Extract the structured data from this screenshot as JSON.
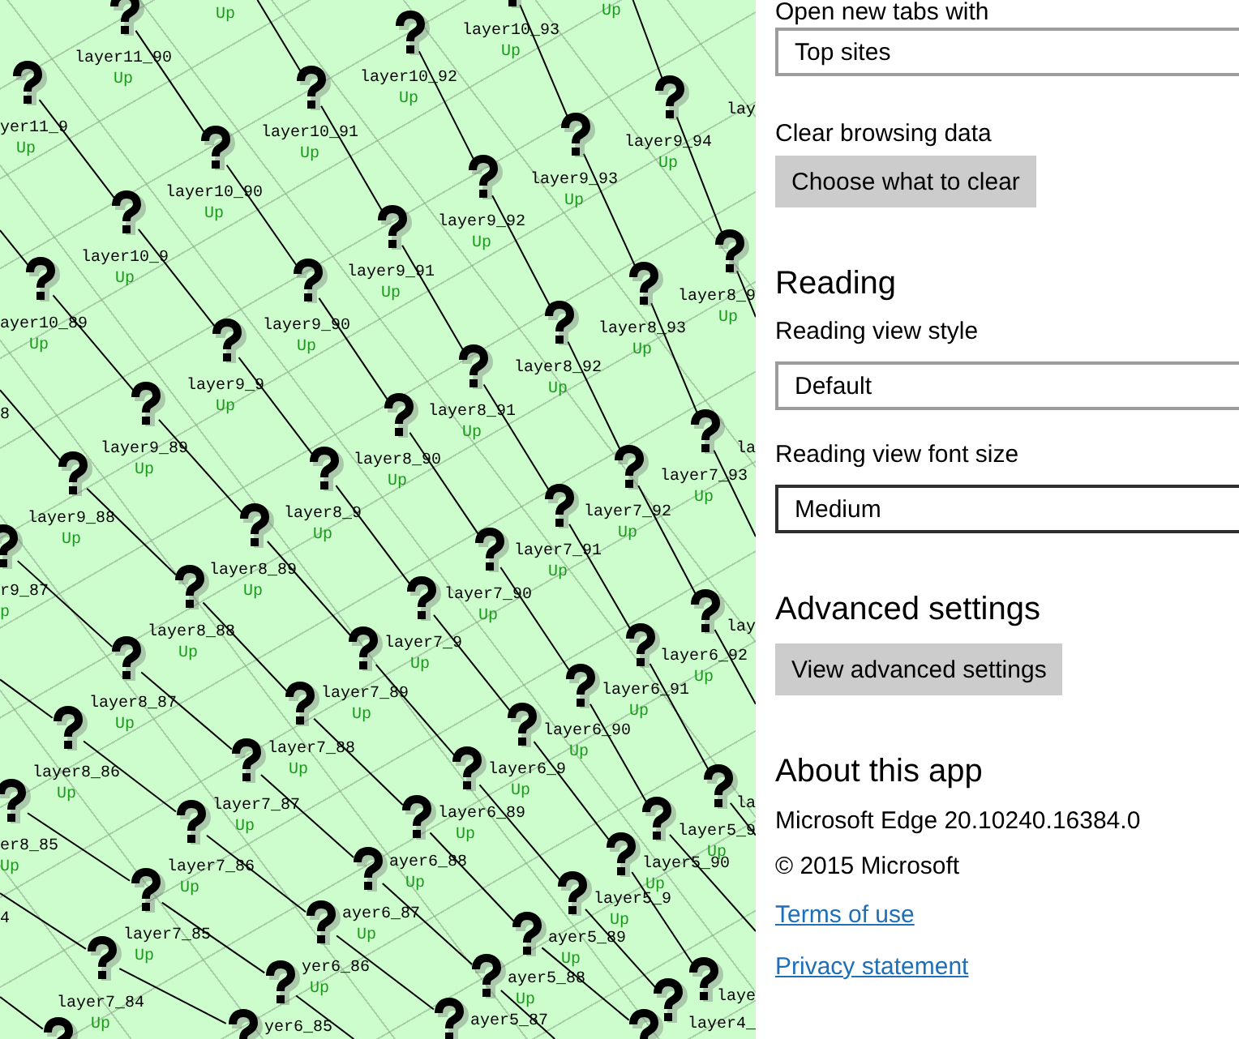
{
  "network_map": {
    "chains": [
      {
        "nodes": [
          {
            "kind": "unknown"
          }
        ]
      },
      {
        "nodes": [
          {
            "label": "4"
          },
          {
            "kind": "unknown",
            "label": "layer7_84",
            "status": "Up"
          },
          {
            "kind": "unknown"
          }
        ]
      },
      {
        "nodes": [
          {
            "kind": "unknown",
            "label": "er8_85",
            "status": "Up"
          },
          {
            "kind": "unknown",
            "label": "layer7_85",
            "status": "Up"
          },
          {
            "kind": "unknown",
            "label": "yer6_85"
          }
        ]
      },
      {
        "nodes": [
          {
            "kind": "unknown",
            "label": "layer8_86",
            "status": "Up"
          },
          {
            "kind": "unknown",
            "label": "layer7_86",
            "status": "Up"
          },
          {
            "kind": "unknown",
            "label": "yer6_86",
            "status": "Up"
          },
          {
            "kind": "unknown"
          }
        ]
      },
      {
        "nodes": [
          {
            "kind": "unknown",
            "label": "r9_87",
            "status": "p"
          },
          {
            "kind": "unknown",
            "label": "layer8_87",
            "status": "Up"
          },
          {
            "kind": "unknown",
            "label": "layer7_87",
            "status": "Up"
          },
          {
            "kind": "unknown",
            "label": "ayer6_87",
            "status": "Up"
          },
          {
            "kind": "unknown",
            "label": "ayer5_87"
          }
        ]
      },
      {
        "nodes": [
          {
            "label": "8"
          },
          {
            "kind": "unknown",
            "label": "layer9_88",
            "status": "Up"
          },
          {
            "kind": "unknown",
            "label": "layer8_88",
            "status": "Up"
          },
          {
            "kind": "unknown",
            "label": "layer7_88",
            "status": "Up"
          },
          {
            "kind": "unknown",
            "label": "ayer6_88",
            "status": "Up"
          },
          {
            "kind": "unknown",
            "label": "ayer5_88",
            "status": "Up"
          },
          {
            "kind": "unknown"
          }
        ]
      },
      {
        "nodes": [
          {
            "kind": "unknown",
            "label": "ayer10_89",
            "status": "Up"
          },
          {
            "kind": "unknown",
            "label": "layer9_89",
            "status": "Up"
          },
          {
            "kind": "unknown",
            "label": "layer8_89",
            "status": "Up"
          },
          {
            "kind": "unknown",
            "label": "layer7_89",
            "status": "Up"
          },
          {
            "kind": "unknown",
            "label": "layer6_89",
            "status": "Up"
          },
          {
            "kind": "unknown",
            "label": "ayer5_89",
            "status": "Up"
          },
          {
            "kind": "unknown"
          }
        ]
      },
      {
        "nodes": [
          {
            "kind": "unknown",
            "label": "yer11_9",
            "status": "Up"
          },
          {
            "kind": "unknown",
            "label": "layer10_9",
            "status": "Up"
          },
          {
            "kind": "unknown",
            "label": "layer9_9",
            "status": "Up"
          },
          {
            "kind": "unknown",
            "label": "layer8_9",
            "status": "Up"
          },
          {
            "kind": "unknown",
            "label": "layer7_9",
            "status": "Up"
          },
          {
            "kind": "unknown",
            "label": "layer6_9",
            "status": "Up"
          },
          {
            "kind": "unknown",
            "label": "layer5_9",
            "status": "Up"
          },
          {
            "kind": "unknown",
            "label": "layer4_"
          }
        ]
      },
      {
        "nodes": [
          {
            "kind": "unknown",
            "label": "layer11_90",
            "status": "Up"
          },
          {
            "kind": "unknown",
            "label": "layer10_90",
            "status": "Up"
          },
          {
            "kind": "unknown",
            "label": "layer9_90",
            "status": "Up"
          },
          {
            "kind": "unknown",
            "label": "layer8_90",
            "status": "Up"
          },
          {
            "kind": "unknown",
            "label": "layer7_90",
            "status": "Up"
          },
          {
            "kind": "unknown",
            "label": "layer6_90",
            "status": "Up"
          },
          {
            "kind": "unknown",
            "label": "layer5_90",
            "status": "Up"
          },
          {
            "label": "laye"
          }
        ]
      },
      {
        "nodes": [
          {
            "status": "Up"
          },
          {
            "kind": "unknown",
            "label": "layer10_91",
            "status": "Up"
          },
          {
            "kind": "unknown",
            "label": "layer9_91",
            "status": "Up"
          },
          {
            "kind": "unknown",
            "label": "layer8_91",
            "status": "Up"
          },
          {
            "kind": "unknown",
            "label": "layer7_91",
            "status": "Up"
          },
          {
            "kind": "unknown",
            "label": "layer6_91",
            "status": "Up"
          },
          {
            "kind": "unknown",
            "label": "layer5_9",
            "status": "Up"
          }
        ]
      },
      {
        "nodes": [
          {
            "kind": "unknown",
            "label": "layer10_92",
            "status": "Up"
          },
          {
            "kind": "unknown",
            "label": "layer9_92",
            "status": "Up"
          },
          {
            "kind": "unknown",
            "label": "layer8_92",
            "status": "Up"
          },
          {
            "kind": "unknown",
            "label": "layer7_92",
            "status": "Up"
          },
          {
            "kind": "unknown",
            "label": "layer6_92",
            "status": "Up"
          },
          {
            "label": "la"
          }
        ]
      },
      {
        "nodes": [
          {
            "kind": "unknown",
            "label": "layer10_93",
            "status": "Up"
          },
          {
            "kind": "unknown",
            "label": "layer9_93",
            "status": "Up"
          },
          {
            "kind": "unknown",
            "label": "layer8_93",
            "status": "Up"
          },
          {
            "kind": "unknown",
            "label": "layer7_93",
            "status": "Up"
          },
          {
            "label": "lay"
          }
        ]
      },
      {
        "nodes": [
          {
            "status": "Up"
          },
          {
            "kind": "unknown",
            "label": "layer9_94",
            "status": "Up"
          },
          {
            "kind": "unknown",
            "label": "layer8_9",
            "status": "Up"
          },
          {
            "label": "la"
          }
        ]
      },
      {
        "nodes": [
          {
            "label": "lay"
          }
        ]
      }
    ]
  },
  "settings": {
    "sections": [
      {
        "items": [
          {
            "kind": "label",
            "text": "Open new tabs with"
          },
          {
            "kind": "dropdown",
            "value": "Top sites",
            "hovered": false
          }
        ]
      },
      {
        "items": [
          {
            "kind": "label",
            "text": "Clear browsing data"
          },
          {
            "kind": "button",
            "text": "Choose what to clear"
          }
        ]
      },
      {
        "heading": "Reading",
        "items": [
          {
            "kind": "label",
            "text": "Reading view style"
          },
          {
            "kind": "dropdown",
            "value": "Default",
            "hovered": false
          },
          {
            "kind": "label",
            "text": "Reading view font size"
          },
          {
            "kind": "dropdown",
            "value": "Medium",
            "hovered": true
          }
        ]
      },
      {
        "heading": "Advanced settings",
        "items": [
          {
            "kind": "button",
            "text": "View advanced settings"
          }
        ]
      },
      {
        "heading": "About this app",
        "items": [
          {
            "kind": "text",
            "text": "Microsoft Edge 20.10240.16384.0"
          },
          {
            "kind": "text",
            "text": "© 2015 Microsoft"
          },
          {
            "kind": "link",
            "text": "Terms of use"
          },
          {
            "kind": "link",
            "text": "Privacy statement"
          }
        ]
      }
    ]
  }
}
